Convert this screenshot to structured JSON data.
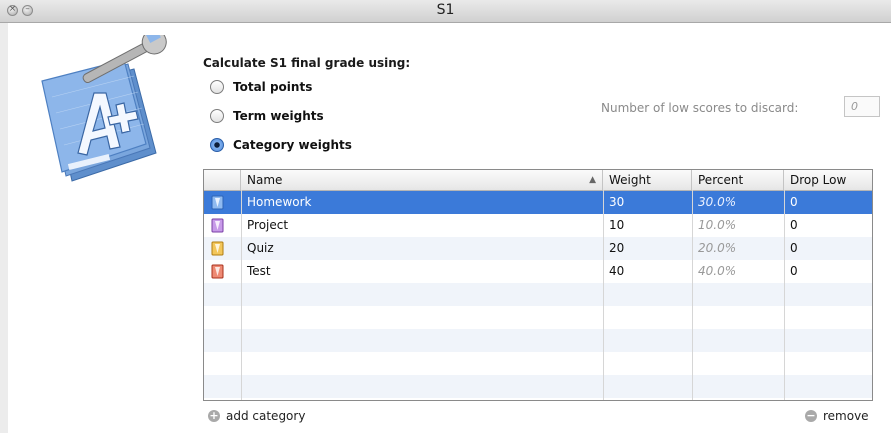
{
  "window": {
    "title": "S1"
  },
  "settings": {
    "heading": "Calculate S1 final grade using:",
    "options": [
      {
        "label": "Total points",
        "selected": false
      },
      {
        "label": "Term weights",
        "selected": false
      },
      {
        "label": "Category weights",
        "selected": true
      }
    ],
    "discard_label": "Number of low scores to discard:",
    "discard_placeholder": "0"
  },
  "table": {
    "columns": [
      "Name",
      "Weight",
      "Percent",
      "Drop Low"
    ],
    "sort_indicator": "▲",
    "rows": [
      {
        "name": "Homework",
        "weight": "30",
        "percent": "30.0%",
        "drop_low": "0",
        "icon": "homework-notebook-icon",
        "color": "#5b8fd8",
        "selected": true
      },
      {
        "name": "Project",
        "weight": "10",
        "percent": "10.0%",
        "drop_low": "0",
        "icon": "project-notebook-icon",
        "color": "#9b59c8",
        "selected": false
      },
      {
        "name": "Quiz",
        "weight": "20",
        "percent": "20.0%",
        "drop_low": "0",
        "icon": "quiz-notebook-icon",
        "color": "#e2a21a",
        "selected": false
      },
      {
        "name": "Test",
        "weight": "40",
        "percent": "40.0%",
        "drop_low": "0",
        "icon": "test-notebook-icon",
        "color": "#d9442c",
        "selected": false
      }
    ]
  },
  "footer": {
    "add_label": "add category",
    "remove_label": "remove"
  }
}
